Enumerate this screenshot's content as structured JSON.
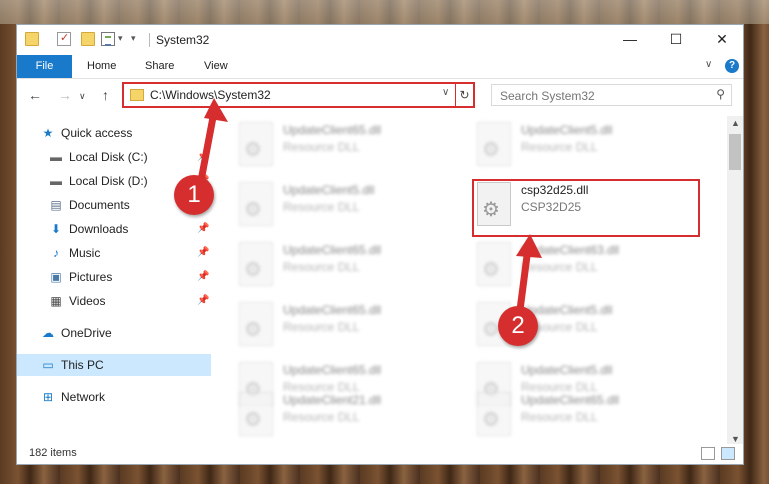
{
  "window": {
    "title": "System32",
    "controls": {
      "minimize": "—",
      "maximize": "☐",
      "close": "✕"
    }
  },
  "ribbon": {
    "tabs": [
      "File",
      "Home",
      "Share",
      "View"
    ]
  },
  "address": {
    "path": "C:\\Windows\\System32"
  },
  "search": {
    "placeholder": "Search System32"
  },
  "nav": {
    "items": [
      {
        "label": "Quick access",
        "icon": "star-icon"
      },
      {
        "label": "Local Disk (C:)",
        "icon": "drive-icon"
      },
      {
        "label": "Local Disk (D:)",
        "icon": "drive-icon"
      },
      {
        "label": "Documents",
        "icon": "documents-icon"
      },
      {
        "label": "Downloads",
        "icon": "download-icon"
      },
      {
        "label": "Music",
        "icon": "music-icon"
      },
      {
        "label": "Pictures",
        "icon": "pictures-icon"
      },
      {
        "label": "Videos",
        "icon": "videos-icon"
      },
      {
        "label": "OneDrive",
        "icon": "cloud-icon"
      },
      {
        "label": "This PC",
        "icon": "computer-icon"
      },
      {
        "label": "Network",
        "icon": "network-icon"
      }
    ]
  },
  "files": [
    {
      "name": "UpdateClient65.dll",
      "type": "Resource DLL"
    },
    {
      "name": "UpdateClient5.dll",
      "type": "Resource DLL"
    },
    {
      "name": "UpdateClient5.dll",
      "type": "Resource DLL"
    },
    {
      "name": "csp32d25.dll",
      "type": "CSP32D25"
    },
    {
      "name": "UpdateClient65.dll",
      "type": "Resource DLL"
    },
    {
      "name": "UpdateClient63.dll",
      "type": "Resource DLL"
    },
    {
      "name": "UpdateClient65.dll",
      "type": "Resource DLL"
    },
    {
      "name": "UpdateClient5.dll",
      "type": "Resource DLL"
    },
    {
      "name": "UpdateClient65.dll",
      "type": "Resource DLL"
    },
    {
      "name": "UpdateClient5.dll",
      "type": "Resource DLL"
    },
    {
      "name": "UpdateClient21.dll",
      "type": "Resource DLL"
    },
    {
      "name": "UpdateClient65.dll",
      "type": "Resource DLL"
    }
  ],
  "status": {
    "item_count": "182 items"
  },
  "annotations": {
    "step1": "1",
    "step2": "2",
    "color": "#d62e2e"
  }
}
